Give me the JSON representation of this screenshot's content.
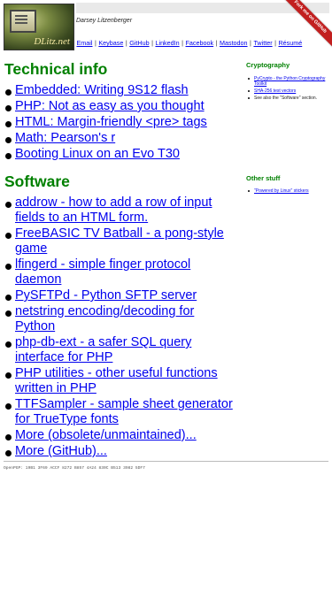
{
  "header": {
    "brand": "DLitz.net",
    "name": "Darsey Litzenberger",
    "links": [
      "Email",
      "Keybase",
      "GitHub",
      "LinkedIn",
      "Facebook",
      "Mastodon",
      "Twitter",
      "Résumé"
    ],
    "ribbon": "Fork me on GitHub"
  },
  "technical": {
    "title": "Technical info",
    "items": [
      "Embedded: Writing 9S12 flash",
      "PHP: Not as easy as you thought",
      "HTML: Margin-friendly <pre> tags",
      "Math: Pearson's r",
      "Booting Linux on an Evo T30"
    ]
  },
  "software": {
    "title": "Software",
    "items": [
      "addrow - how to add a row of input fields to an HTML form.",
      "FreeBASIC TV Batball - a pong-style game",
      "lfingerd - simple finger protocol daemon",
      "PySFTPd - Python SFTP server",
      "netstring encoding/decoding for Python",
      "php-db-ext - a safer SQL query interface for PHP",
      "PHP utilities - other useful functions written in PHP",
      "TTFSampler - sample sheet generator for TrueType fonts",
      "More (obsolete/unmaintained)...",
      "More (GitHub)..."
    ]
  },
  "sidebar": {
    "crypto_title": "Cryptography",
    "crypto_items": [
      "PyCrypto - the Python Cryptography Toolkit",
      "SHA-256 test vectors"
    ],
    "crypto_note": "See also the \"Software\" section.",
    "other_title": "Other stuff",
    "other_items": [
      "\"Powered by Linux\" stickers"
    ]
  },
  "footer": {
    "openpgp": "OpenPGP: 19B1 3F69 ACCF 8272 B857  4A24 830C B513 3982 5DF7"
  }
}
